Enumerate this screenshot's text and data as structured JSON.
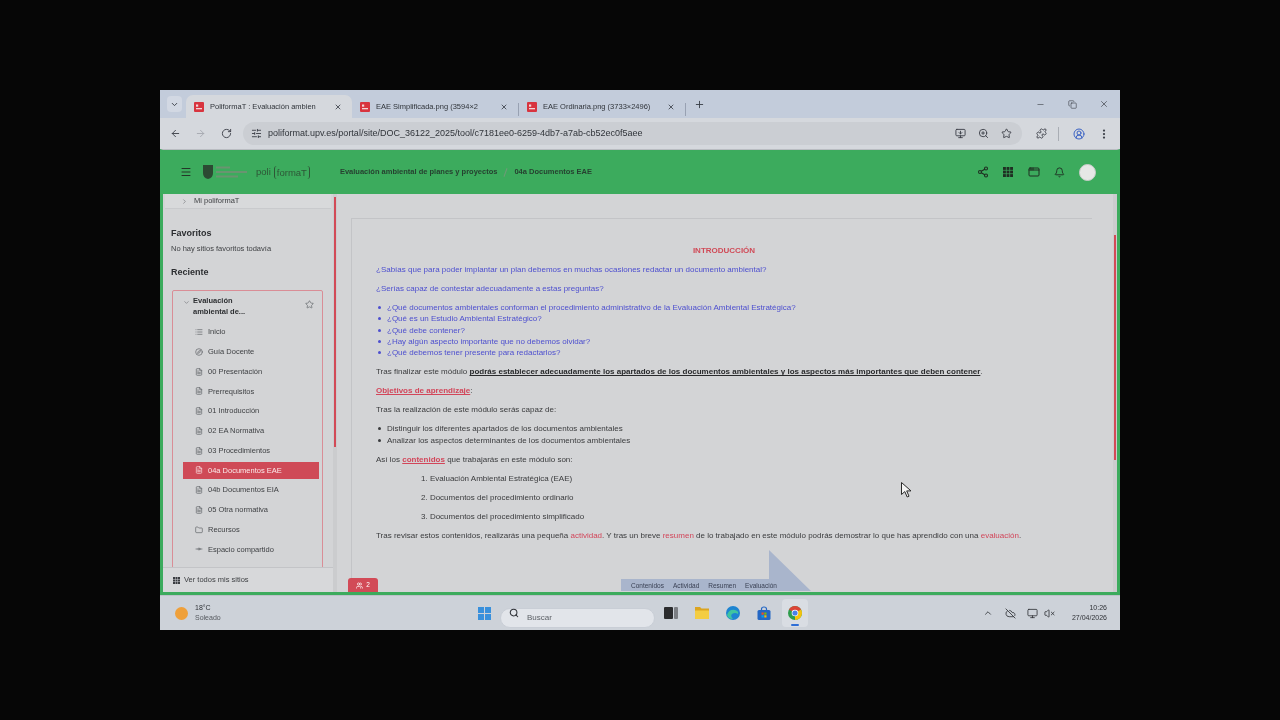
{
  "browser": {
    "tabs": [
      {
        "title": "PoliformaT : Evaluación ambien",
        "selected": true
      },
      {
        "title": "EAE Simplificada.png (3594×2",
        "selected": false
      },
      {
        "title": "EAE Ordinaria.png (3733×2496)",
        "selected": false
      }
    ],
    "nav": [
      {
        "kind": "back",
        "disabled": false
      },
      {
        "kind": "forward",
        "disabled": true
      },
      {
        "kind": "reload",
        "disabled": false
      }
    ],
    "url": "poliformat.upv.es/portal/site/DOC_36122_2025/tool/c7181ee0-6259-4db7-a7ab-cb52ec0f5aee"
  },
  "header": {
    "logo": {
      "prefix": "poli",
      "name": "formaT"
    },
    "breadcrumb": [
      "Evaluación ambiental de planes y proyectos",
      "04a Documentos EAE"
    ]
  },
  "sidebar": {
    "my_sites": {
      "label": "Mi poliformaT",
      "expanded": false
    },
    "favorites": {
      "title": "Favoritos",
      "empty_text": "No hay sitios favoritos todavía"
    },
    "recent": {
      "title": "Reciente",
      "site": {
        "name": "Evaluación ambiental de...",
        "expanded": true,
        "favorite": false,
        "tools": [
          {
            "label": "Inicio",
            "kind": "overview",
            "selected": false
          },
          {
            "label": "Guía Docente",
            "kind": "syllabus",
            "selected": false
          },
          {
            "label": "00 Presentación",
            "kind": "page",
            "selected": false
          },
          {
            "label": "Prerrequisitos",
            "kind": "page",
            "selected": false
          },
          {
            "label": "01 Introducción",
            "kind": "page",
            "selected": false
          },
          {
            "label": "02 EA Normativa",
            "kind": "page",
            "selected": false
          },
          {
            "label": "03 Procedimientos",
            "kind": "page",
            "selected": false
          },
          {
            "label": "04a Documentos EAE",
            "kind": "page",
            "selected": true
          },
          {
            "label": "04b Documentos EIA",
            "kind": "page",
            "selected": false
          },
          {
            "label": "05 Otra normativa",
            "kind": "page",
            "selected": false
          },
          {
            "label": "Recursos",
            "kind": "folder",
            "selected": false
          },
          {
            "label": "Espacio compartido",
            "kind": "shared",
            "selected": false
          }
        ]
      }
    },
    "all_sites": "Ver todos mis sitios"
  },
  "content": {
    "heading": "INTRODUCCIÓN",
    "blocks": [
      {
        "kind": "question",
        "text": "¿Sabías que para poder implantar un plan debemos en muchas ocasiones redactar un documento ambiental?"
      },
      {
        "kind": "question",
        "text": "¿Serías capaz de contestar adecuadamente a estas preguntas?"
      },
      {
        "kind": "question_list",
        "items": [
          "¿Qué documentos ambientales conforman el procedimiento administrativo de la Evaluación Ambiental Estratégica?",
          "¿Qué es un Estudio Ambiental Estratégico?",
          "¿Qué debe contener?",
          "¿Hay algún aspecto importante que no debemos olvidar?",
          "¿Qué debemos tener presente para redactarlos?"
        ]
      },
      {
        "kind": "paragraph",
        "parts": [
          {
            "kind": "plain",
            "text": "Tras finalizar este módulo "
          },
          {
            "kind": "emphasis",
            "text": "podrás establecer adecuadamente los apartados de los documentos ambientales y los aspectos más importantes que deben contener"
          },
          {
            "kind": "plain",
            "text": "."
          }
        ]
      },
      {
        "kind": "paragraph",
        "parts": [
          {
            "kind": "strong_link",
            "text": "Objetivos de aprendizaje"
          },
          {
            "kind": "plain",
            "text": ":"
          }
        ]
      },
      {
        "kind": "paragraph",
        "parts": [
          {
            "kind": "plain",
            "text": "Tras la realización de este módulo serás capaz de:"
          }
        ]
      },
      {
        "kind": "list",
        "items": [
          "Distinguir los diferentes apartados de los documentos ambientales",
          "Analizar los aspectos determinantes de los documentos ambientales"
        ]
      },
      {
        "kind": "paragraph",
        "parts": [
          {
            "kind": "plain",
            "text": "Así los "
          },
          {
            "kind": "strong_link",
            "text": "contenidos"
          },
          {
            "kind": "plain",
            "text": " que trabajarás en este módulo son:"
          }
        ]
      },
      {
        "kind": "numbered",
        "items": [
          "1. Evaluación Ambiental Estratégica (EAE)",
          "2. Documentos del procedimiento ordinario",
          "3. Documentos del procedimiento simplificado"
        ]
      },
      {
        "kind": "paragraph",
        "parts": [
          {
            "kind": "plain",
            "text": "Tras revisar estos contenidos, realizarás una pequeña "
          },
          {
            "kind": "link",
            "text": "actividad"
          },
          {
            "kind": "plain",
            "text": ". Y tras un breve "
          },
          {
            "kind": "link",
            "text": "resumen"
          },
          {
            "kind": "plain",
            "text": " de lo trabajado en este módulo podrás demostrar lo que has aprendido con una "
          },
          {
            "kind": "link",
            "text": "evaluación"
          },
          {
            "kind": "plain",
            "text": "."
          }
        ]
      }
    ],
    "arrow_labels": [
      "Contenidos",
      "Actividad",
      "Resumen",
      "Evaluación"
    ],
    "participants": {
      "count": "2"
    }
  },
  "taskbar": {
    "weather": {
      "temperature": "18°C",
      "condition": "Soleado"
    },
    "search": {
      "placeholder": "Buscar"
    },
    "apps": [
      {
        "kind": "task_view",
        "selected": false
      },
      {
        "kind": "files",
        "selected": false
      },
      {
        "kind": "edge",
        "selected": false
      },
      {
        "kind": "store",
        "selected": false
      },
      {
        "kind": "chrome",
        "selected": true
      }
    ],
    "clock": {
      "time": "10:26",
      "date": "27/04/2026"
    }
  }
}
